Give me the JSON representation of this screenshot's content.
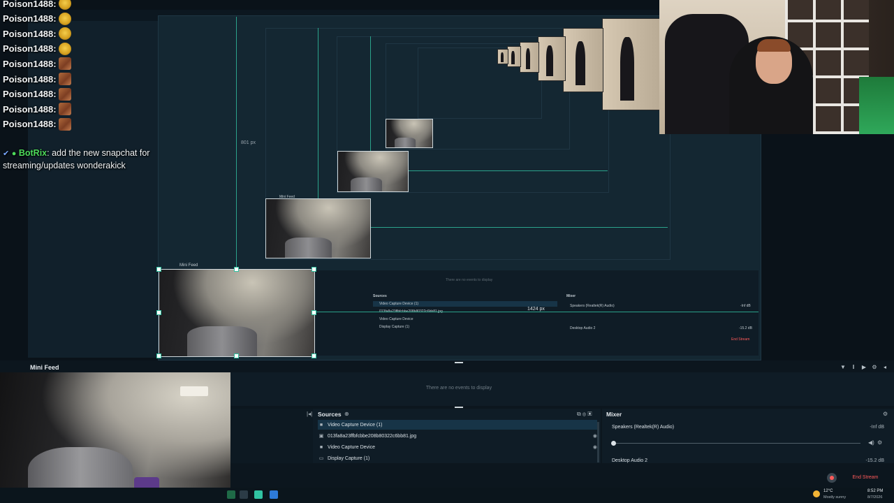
{
  "chat": {
    "messages": [
      {
        "user": "Poison1488:",
        "emote": "ok"
      },
      {
        "user": "Poison1488:",
        "emote": "ok"
      },
      {
        "user": "Poison1488:",
        "emote": "ok"
      },
      {
        "user": "Poison1488:",
        "emote": "ok"
      },
      {
        "user": "Poison1488:",
        "emote": "bread"
      },
      {
        "user": "Poison1488:",
        "emote": "bread"
      },
      {
        "user": "Poison1488:",
        "emote": "bread"
      },
      {
        "user": "Poison1488:",
        "emote": "bread"
      },
      {
        "user": "Poison1488:",
        "emote": "bread"
      }
    ],
    "bot_user": "BotRix",
    "bot_message": ": add the new snapchat for streaming/updates wonderakick"
  },
  "canvas": {
    "width_readout": "801 px",
    "height_readout": "1424 px",
    "nested_source_label": "Mini Feed",
    "nested_events": "There are no events to display",
    "nested_sources_title": "Sources",
    "nested_mixer_title": "Mixer",
    "nested_sources": [
      "Video Capture Device (1)",
      "013fa8a23ffbfcbbe208b80322c6bb81.jpg",
      "Video Capture Device",
      "Display Capture (1)"
    ],
    "nested_mixer": [
      "Speakers (Realtek(R) Audio)",
      "Desktop Audio 2"
    ],
    "nested_mixer_vals": [
      "-Inf dB",
      "-15.2 dB"
    ],
    "nested_end_stream": "End Stream"
  },
  "editor": {
    "mini_feed_label": "Mini Feed",
    "events_empty": "There are no events to display",
    "sources_title": "Sources",
    "sources": [
      {
        "icon": "camera-icon",
        "label": "Video Capture Device (1)",
        "selected": true
      },
      {
        "icon": "image-icon",
        "label": "013fa8a23ffbfcbbe208b80322c6bb81.jpg"
      },
      {
        "icon": "camera-icon",
        "label": "Video Capture Device"
      },
      {
        "icon": "monitor-icon",
        "label": "Display Capture (1)"
      }
    ],
    "mixer_title": "Mixer",
    "mixer": [
      {
        "label": "Speakers (Realtek(R) Audio)",
        "value": "-Inf dB"
      },
      {
        "label": "Desktop Audio 2",
        "value": "-15.2 dB"
      }
    ],
    "end_stream": "End Stream"
  },
  "taskbar": {
    "temperature": "12°C",
    "weather": "Mostly sunny",
    "time": "8:52 PM",
    "date": "8/7/2026"
  },
  "colors": {
    "accent": "#31c3a2",
    "end_stream": "#ff5a5a",
    "bot_name": "#4ddb5b"
  }
}
